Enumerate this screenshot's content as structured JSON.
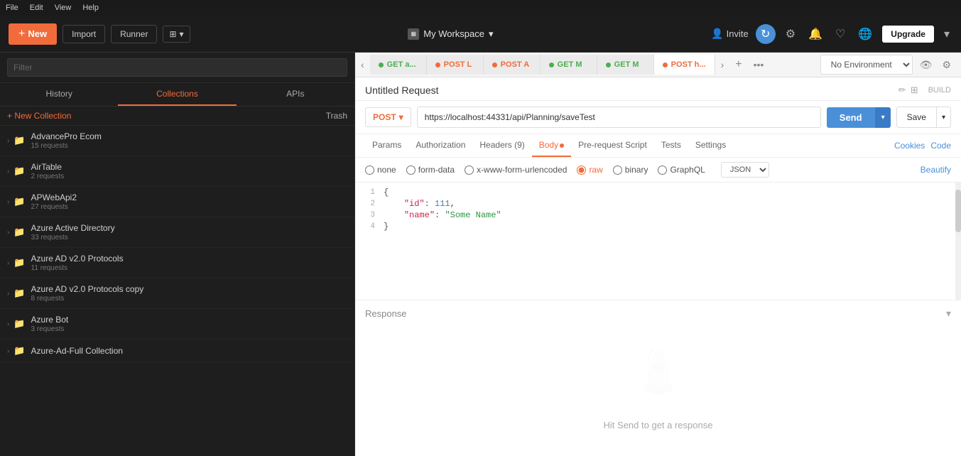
{
  "menu": {
    "items": [
      "File",
      "Edit",
      "View",
      "Help"
    ]
  },
  "toolbar": {
    "new_label": "New",
    "import_label": "Import",
    "runner_label": "Runner",
    "workspace_name": "My Workspace",
    "invite_label": "Invite",
    "upgrade_label": "Upgrade"
  },
  "sidebar": {
    "filter_placeholder": "Filter",
    "tab_history": "History",
    "tab_collections": "Collections",
    "tab_apis": "APIs",
    "new_collection_label": "+ New Collection",
    "trash_label": "Trash",
    "collections": [
      {
        "name": "AdvancePro Ecom",
        "count": "15 requests"
      },
      {
        "name": "AirTable",
        "count": "2 requests"
      },
      {
        "name": "APWebApi2",
        "count": "27 requests"
      },
      {
        "name": "Azure Active Directory",
        "count": "33 requests"
      },
      {
        "name": "Azure AD v2.0 Protocols",
        "count": "11 requests"
      },
      {
        "name": "Azure AD v2.0 Protocols copy",
        "count": "8 requests"
      },
      {
        "name": "Azure Bot",
        "count": "3 requests"
      },
      {
        "name": "Azure-Ad-Full Collection",
        "count": ""
      }
    ]
  },
  "request": {
    "title": "Untitled Request",
    "build_label": "BUILD",
    "method": "POST",
    "url": "https://localhost:44331/api/Planning/saveTest",
    "send_label": "Send",
    "save_label": "Save",
    "tabs": {
      "params": "Params",
      "auth": "Authorization",
      "headers": "Headers (9)",
      "body": "Body",
      "pre_request": "Pre-request Script",
      "tests": "Tests",
      "settings": "Settings",
      "cookies": "Cookies",
      "code": "Code"
    },
    "body_options": [
      "none",
      "form-data",
      "x-www-form-urlencoded",
      "raw",
      "binary",
      "GraphQL"
    ],
    "json_label": "JSON",
    "beautify_label": "Beautify",
    "code_lines": [
      {
        "num": "1",
        "content": "{"
      },
      {
        "num": "2",
        "content": "    \"id\": 111,"
      },
      {
        "num": "3",
        "content": "    \"name\": \"Some Name\""
      },
      {
        "num": "4",
        "content": "}"
      }
    ]
  },
  "tabs_bar": {
    "tabs": [
      {
        "method": "GET",
        "label": "GET a...",
        "type": "get",
        "active": false
      },
      {
        "method": "POST",
        "label": "POST L",
        "type": "post",
        "active": false
      },
      {
        "method": "POST",
        "label": "POST A",
        "type": "post",
        "active": false
      },
      {
        "method": "GET",
        "label": "GET M",
        "type": "get",
        "active": false
      },
      {
        "method": "GET",
        "label": "GET M",
        "type": "get",
        "active": false
      },
      {
        "method": "POST",
        "label": "POST h...",
        "type": "post",
        "active": true
      }
    ]
  },
  "environment": {
    "placeholder": "No Environment"
  },
  "response": {
    "label": "Response",
    "hint": "Hit Send to get a response"
  }
}
